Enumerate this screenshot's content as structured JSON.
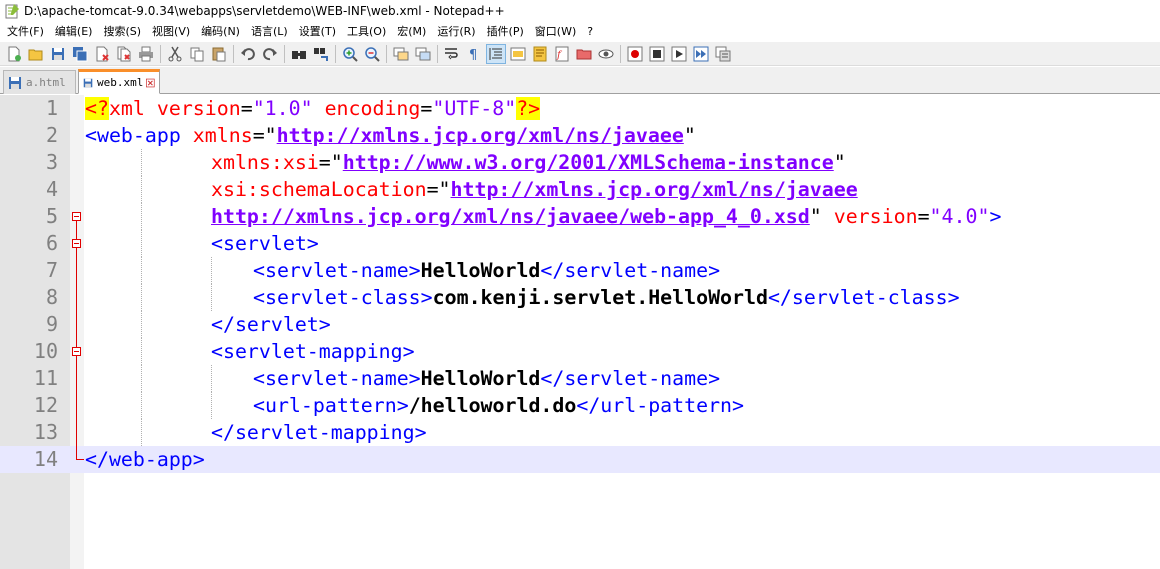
{
  "window": {
    "title": "D:\\apache-tomcat-9.0.34\\webapps\\servletdemo\\WEB-INF\\web.xml - Notepad++"
  },
  "menu": [
    {
      "label": "文件(F)"
    },
    {
      "label": "编辑(E)"
    },
    {
      "label": "搜索(S)"
    },
    {
      "label": "视图(V)"
    },
    {
      "label": "编码(N)"
    },
    {
      "label": "语言(L)"
    },
    {
      "label": "设置(T)"
    },
    {
      "label": "工具(O)"
    },
    {
      "label": "宏(M)"
    },
    {
      "label": "运行(R)"
    },
    {
      "label": "插件(P)"
    },
    {
      "label": "窗口(W)"
    },
    {
      "label": "?"
    }
  ],
  "tabs": [
    {
      "label": "a.html",
      "active": false
    },
    {
      "label": "web.xml",
      "active": true
    }
  ],
  "editor": {
    "current_line": 14,
    "line_numbers": [
      "1",
      "2",
      "3",
      "4",
      "5",
      "6",
      "7",
      "8",
      "9",
      "10",
      "11",
      "12",
      "13",
      "14"
    ],
    "lines": {
      "l1": {
        "pi_open": "<?",
        "xml": "xml",
        "attr1": "version",
        "eq1": "=",
        "val1": "\"1.0\"",
        "attr2": "encoding",
        "eq2": "=",
        "val2": "\"UTF-8\"",
        "pi_close": "?>"
      },
      "l2": {
        "tag": "<web-app",
        "attr": "xmlns",
        "eq": "=",
        "q1": "\"",
        "link": "http://xmlns.jcp.org/xml/ns/javaee",
        "q2": "\""
      },
      "l3": {
        "attr": "xmlns:xsi",
        "eq": "=",
        "q1": "\"",
        "link": "http://www.w3.org/2001/XMLSchema-instance",
        "q2": "\""
      },
      "l4": {
        "attr": "xsi:schemaLocation",
        "eq": "=",
        "q1": "\"",
        "link": "http://xmlns.jcp.org/xml/ns/javaee"
      },
      "l5": {
        "link": "http://xmlns.jcp.org/xml/ns/javaee/web-app_4_0.xsd",
        "q2": "\"",
        "attr": "version",
        "eq": "=",
        "val": "\"4.0\"",
        "close": ">"
      },
      "l6": {
        "tag": "<servlet>"
      },
      "l7": {
        "open": "<servlet-name>",
        "text": "HelloWorld",
        "close": "</servlet-name>"
      },
      "l8": {
        "open": "<servlet-class>",
        "text": "com.kenji.servlet.HelloWorld",
        "close": "</servlet-class>"
      },
      "l9": {
        "tag": "</servlet>"
      },
      "l10": {
        "tag": "<servlet-mapping>"
      },
      "l11": {
        "open": "<servlet-name>",
        "text": "HelloWorld",
        "close": "</servlet-name>"
      },
      "l12": {
        "open": "<url-pattern>",
        "text": "/helloworld.do",
        "close": "</url-pattern>"
      },
      "l13": {
        "tag": "</servlet-mapping>"
      },
      "l14": {
        "tag": "</web-app>"
      }
    }
  },
  "toolbar": {
    "icons": [
      "new-file-icon",
      "open-file-icon",
      "save-icon",
      "save-all-icon",
      "close-icon",
      "close-all-icon",
      "print-icon",
      "cut-icon",
      "copy-icon",
      "paste-icon",
      "undo-icon",
      "redo-icon",
      "find-icon",
      "replace-icon",
      "zoom-in-icon",
      "zoom-out-icon",
      "sync-vertical-icon",
      "sync-horizontal-icon",
      "word-wrap-icon",
      "show-all-chars-icon",
      "indent-guide-icon",
      "udl-icon",
      "doc-map-icon",
      "function-list-icon",
      "folder-workspace-icon",
      "monitor-icon",
      "record-macro-icon",
      "stop-macro-icon",
      "play-macro-icon",
      "run-macro-multiple-icon",
      "save-macro-icon"
    ]
  }
}
